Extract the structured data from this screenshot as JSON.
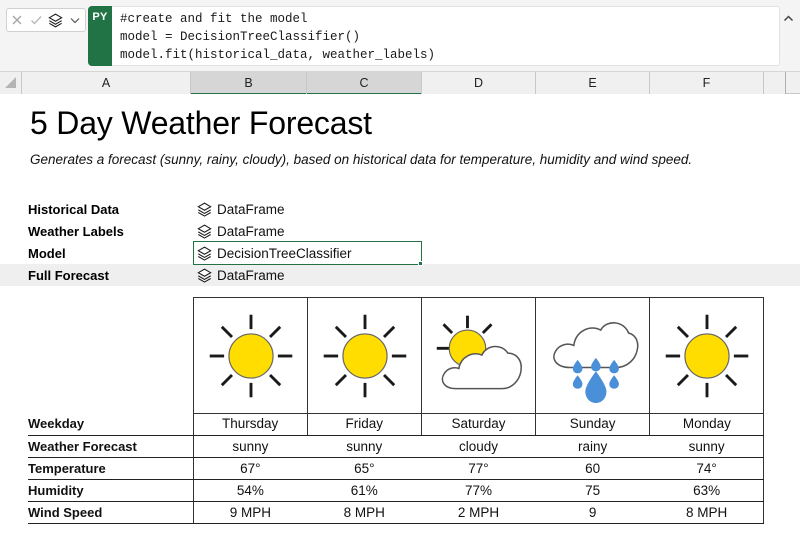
{
  "formula_bar": {
    "cancel_icon": "close-x-icon",
    "confirm_icon": "checkmark-icon",
    "object_icon": "layers-diamond-icon",
    "dropdown_icon": "chevron-down-icon",
    "expand_icon": "chevron-up-icon",
    "language_badge": "PY",
    "code_lines": [
      "#create and fit the model",
      "model = DecisionTreeClassifier()",
      "model.fit(historical_data, weather_labels)"
    ]
  },
  "columns": [
    {
      "label": "A",
      "selected": false
    },
    {
      "label": "B",
      "selected": true
    },
    {
      "label": "C",
      "selected": true
    },
    {
      "label": "D",
      "selected": false
    },
    {
      "label": "E",
      "selected": false
    },
    {
      "label": "F",
      "selected": false
    }
  ],
  "sheet": {
    "title": "5 Day Weather Forecast",
    "subtitle": "Generates a forecast (sunny, rainy, cloudy), based on historical data for temperature, humidity and wind speed.",
    "params": [
      {
        "label": "Historical Data",
        "value": "DataFrame",
        "icon": "dataframe-object-icon",
        "selected": false,
        "shaded": false
      },
      {
        "label": "Weather Labels",
        "value": "DataFrame",
        "icon": "dataframe-object-icon",
        "selected": false,
        "shaded": false
      },
      {
        "label": "Model",
        "value": "DecisionTreeClassifier",
        "icon": "dataframe-object-icon",
        "selected": true,
        "shaded": false
      },
      {
        "label": "Full Forecast",
        "value": "DataFrame",
        "icon": "dataframe-object-icon",
        "selected": false,
        "shaded": true
      }
    ]
  },
  "forecast": {
    "row_labels": [
      "Weekday",
      "Weather Forecast",
      "Temperature",
      "Humidity",
      "Wind Speed"
    ],
    "days": [
      {
        "icon": "sun-icon",
        "weekday": "Thursday",
        "weather_forecast": "sunny",
        "temperature": "67°",
        "humidity": "54%",
        "wind_speed": "9 MPH"
      },
      {
        "icon": "sun-icon",
        "weekday": "Friday",
        "weather_forecast": "sunny",
        "temperature": "65°",
        "humidity": "61%",
        "wind_speed": "8 MPH"
      },
      {
        "icon": "sun-behind-cloud-icon",
        "weekday": "Saturday",
        "weather_forecast": "cloudy",
        "temperature": "77°",
        "humidity": "77%",
        "wind_speed": "2 MPH"
      },
      {
        "icon": "rain-cloud-icon",
        "weekday": "Sunday",
        "weather_forecast": "rainy",
        "temperature": "60",
        "humidity": "75",
        "wind_speed": "9"
      },
      {
        "icon": "sun-icon",
        "weekday": "Monday",
        "weather_forecast": "sunny",
        "temperature": "74°",
        "humidity": "63%",
        "wind_speed": "8 MPH"
      }
    ]
  },
  "colors": {
    "excel_green": "#217346",
    "sun_yellow": "#FFDD00",
    "rain_blue": "#4A90D9",
    "cloud_outline": "#555555",
    "shaded_row": "#efefef"
  }
}
